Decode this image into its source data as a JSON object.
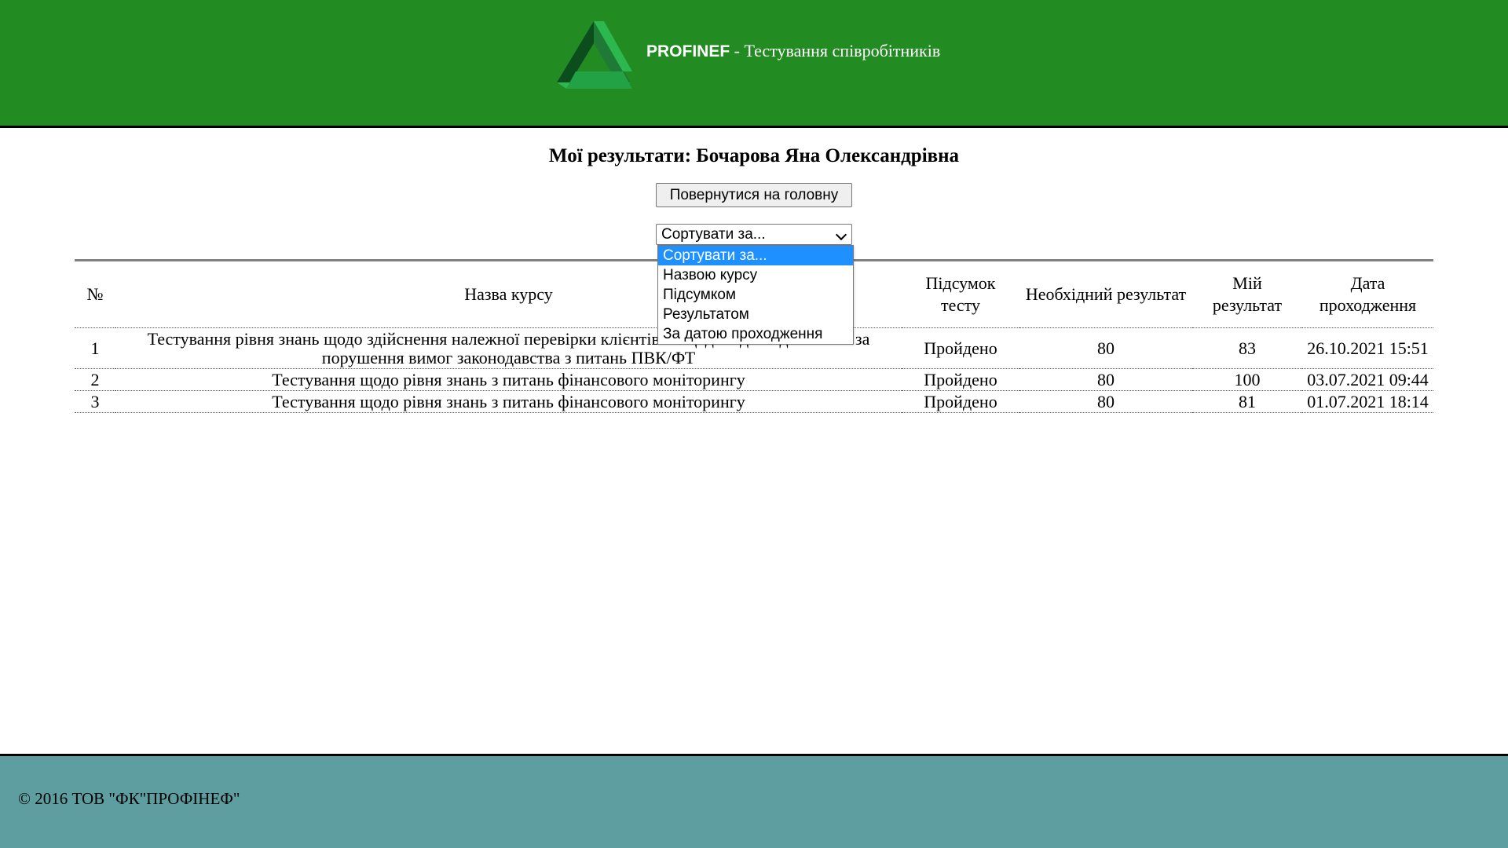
{
  "header": {
    "brand_name": "PROFINEF",
    "brand_subtitle": " - Тестування співробітників",
    "logo_colors": [
      "#0b4d1c",
      "#2db84f",
      "#1f7a35"
    ]
  },
  "page": {
    "title": "Мої результати: Бочарова Яна Олександрівна",
    "home_button": "Повернутися на головну"
  },
  "sort": {
    "selected": "Сортувати за...",
    "options": [
      "Сортувати за...",
      "Назвою курсу",
      "Підсумком",
      "Результатом",
      "За датою проходження"
    ]
  },
  "table": {
    "headers": [
      "№",
      "Назва курсу",
      "Підсумок тесту",
      "Необхідний результат",
      "Мій результат",
      "Дата проходження"
    ],
    "rows": [
      [
        "1",
        "Тестування рівня знань щодо здійснення належної перевірки клієнтів та щодо відповідальності за порушення вимог законодавства з питань ПВК/ФТ",
        "Пройдено",
        "80",
        "83",
        "26.10.2021 15:51"
      ],
      [
        "2",
        "Тестування щодо рівня знань з питань фінансового моніторингу",
        "Пройдено",
        "80",
        "100",
        "03.07.2021 09:44"
      ],
      [
        "3",
        "Тестування щодо рівня знань з питань фінансового моніторингу",
        "Пройдено",
        "80",
        "81",
        "01.07.2021 18:14"
      ]
    ]
  },
  "footer": {
    "copyright": "© 2016 ТОВ \"ФК\"ПРОФІНЕФ\""
  },
  "colors": {
    "header_bg": "#228b22",
    "footer_bg": "#5f9ea0",
    "selected_option_bg": "#1e90ff"
  }
}
